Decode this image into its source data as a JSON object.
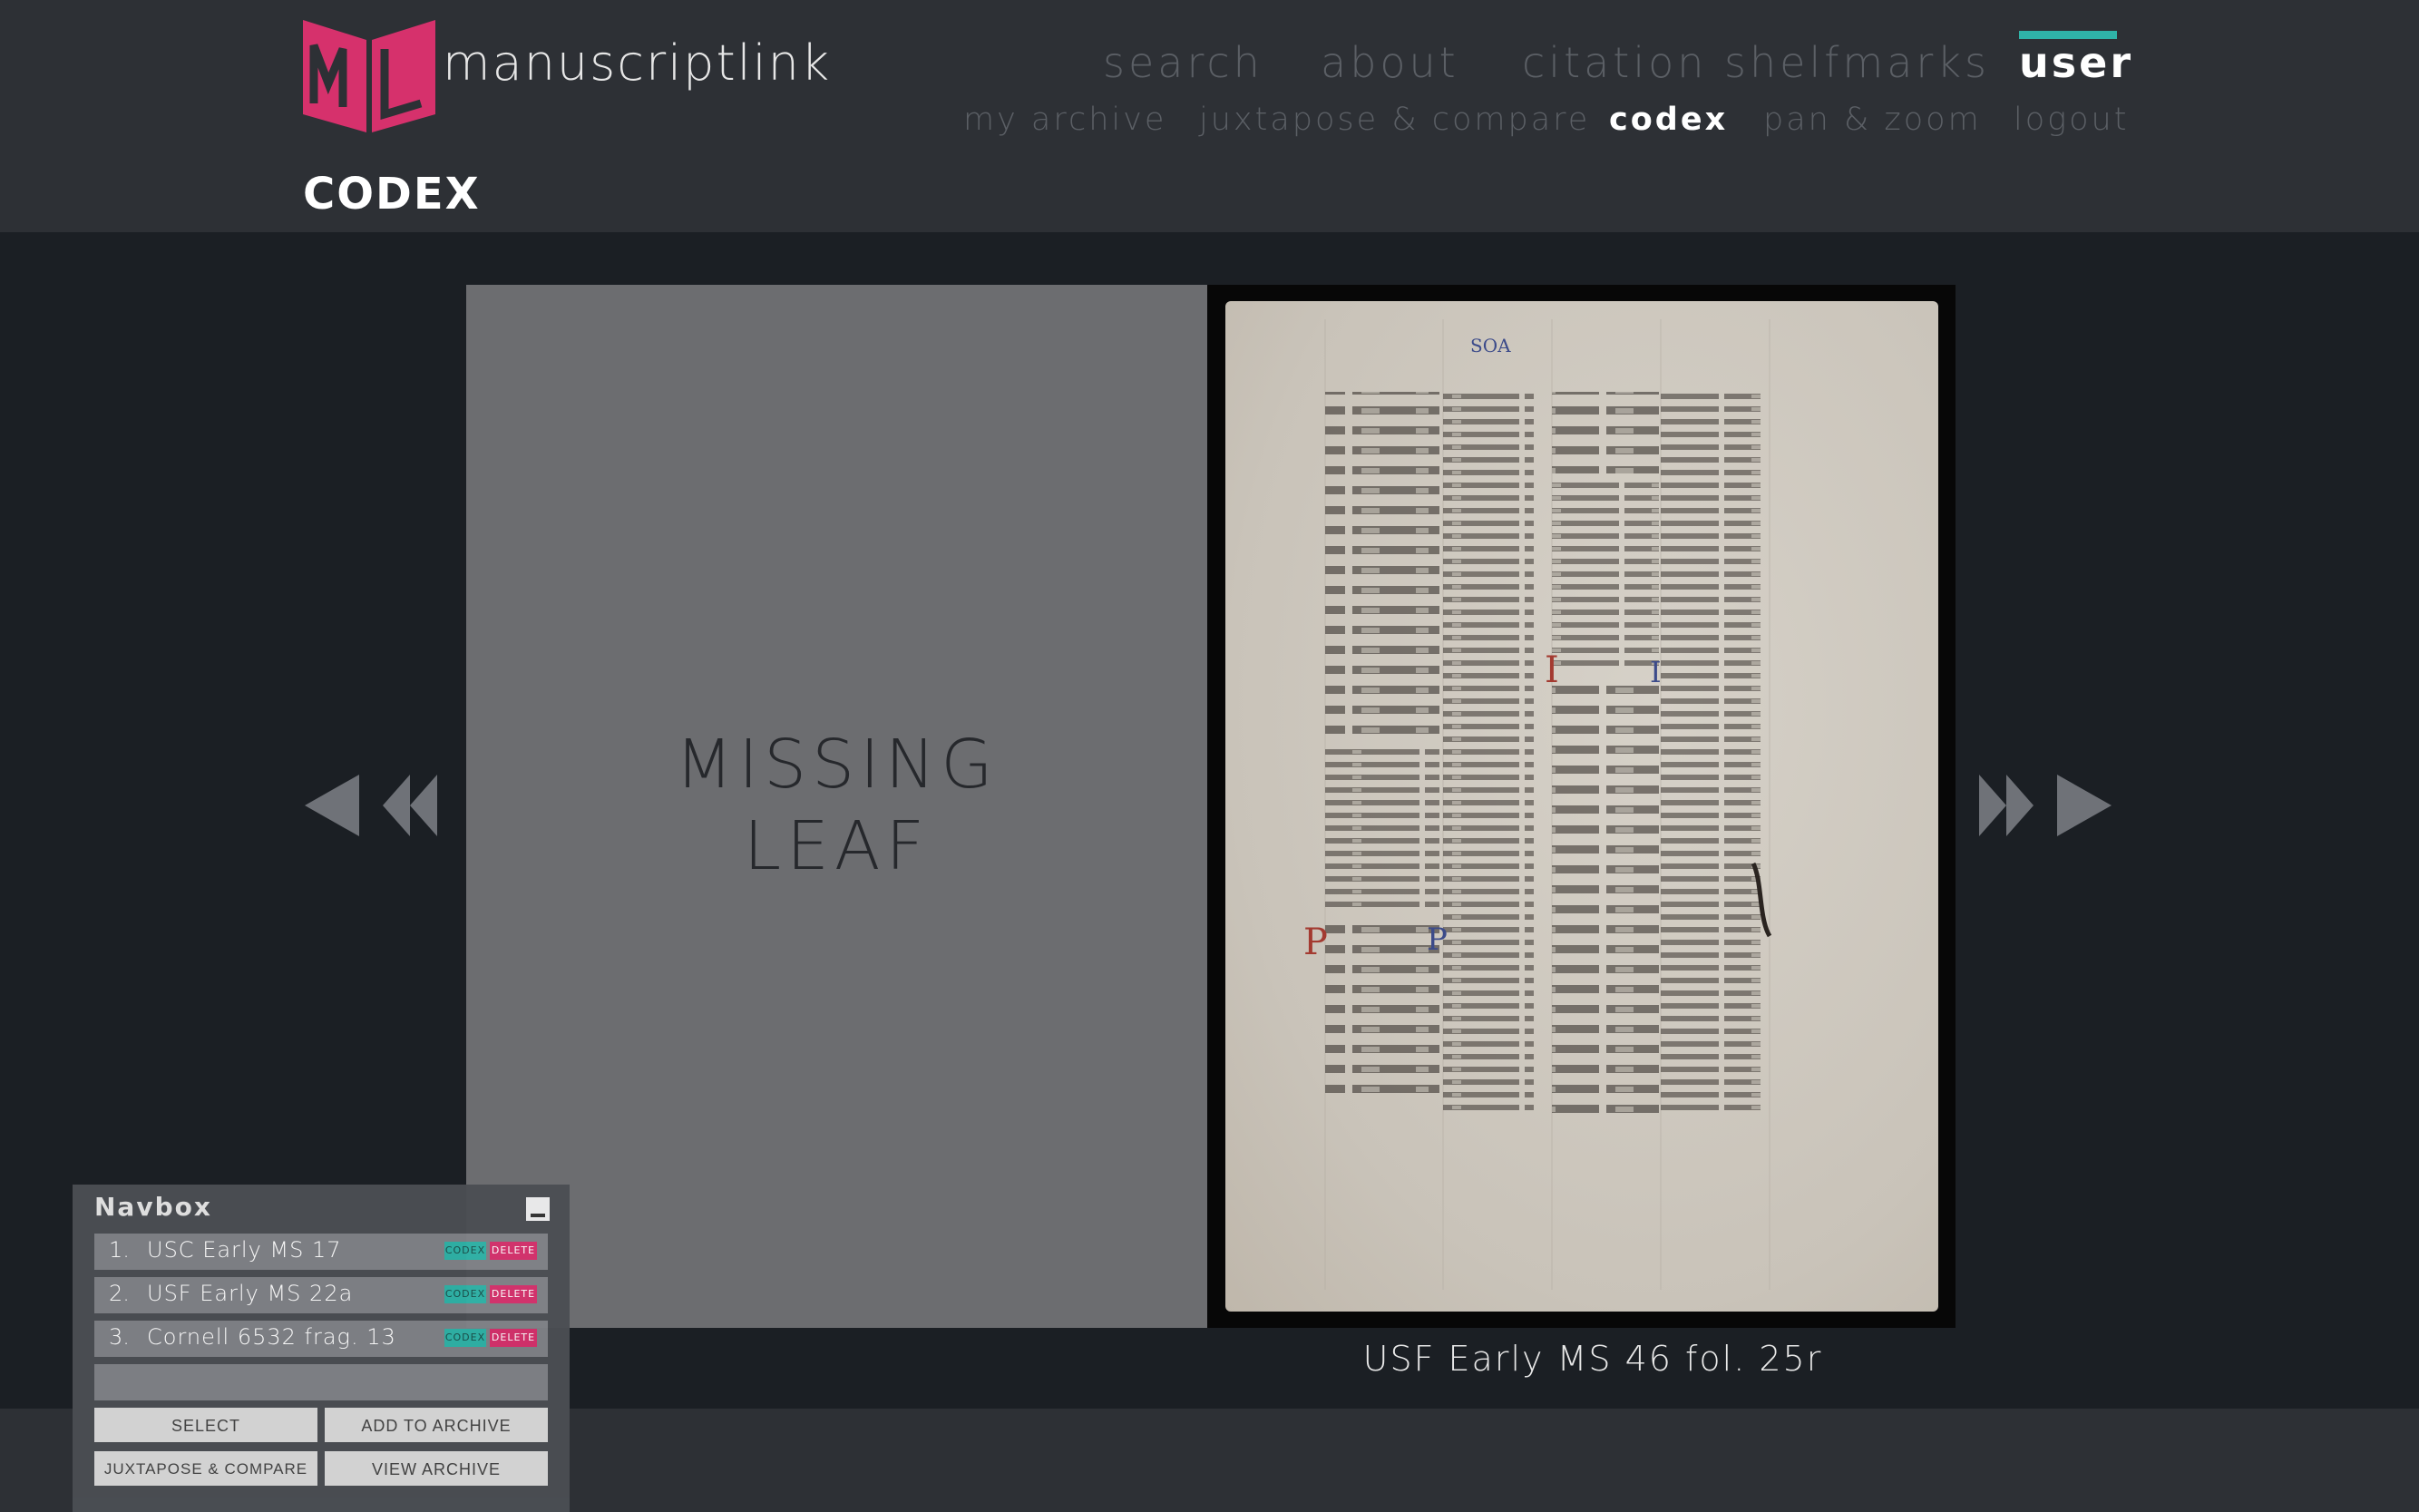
{
  "brand": {
    "name": "manuscriptlink",
    "logo_letters": "ML",
    "logo_color": "#d6316c"
  },
  "nav": {
    "top": [
      "search",
      "about",
      "citation shelfmarks",
      "user"
    ],
    "sub": [
      "my archive",
      "juxtapose & compare",
      "codex",
      "pan & zoom",
      "logout"
    ],
    "active_top": "user",
    "active_sub": "codex",
    "accent": "#2fb3a8"
  },
  "page_title": "CODEX",
  "viewer": {
    "missing_leaf_line1": "MISSING",
    "missing_leaf_line2": "LEAF",
    "caption": "USF Early MS 46 fol. 25r",
    "prev_icons": [
      "prev-leaf-icon",
      "rewind-icon"
    ],
    "next_icons": [
      "fast-forward-icon",
      "next-leaf-icon"
    ]
  },
  "navbox": {
    "title": "Navbox",
    "items": [
      {
        "num": "1.",
        "name": "USC Early MS 17",
        "codex_label": "CODEX",
        "delete_label": "DELETE"
      },
      {
        "num": "2.",
        "name": "USF Early MS 22a",
        "codex_label": "CODEX",
        "delete_label": "DELETE"
      },
      {
        "num": "3.",
        "name": "Cornell 6532 frag. 13",
        "codex_label": "CODEX",
        "delete_label": "DELETE"
      }
    ],
    "buttons": {
      "select": "SELECT",
      "add_to_archive": "ADD TO ARCHIVE",
      "juxtapose": "JUXTAPOSE & COMPARE",
      "view_archive": "VIEW ARCHIVE"
    }
  }
}
